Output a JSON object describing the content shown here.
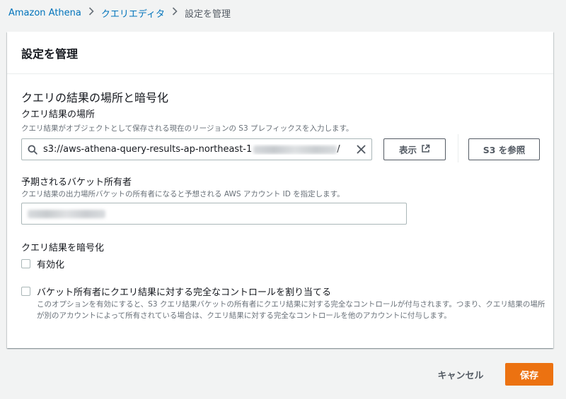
{
  "breadcrumb": {
    "items": [
      "Amazon Athena",
      "クエリエディタ"
    ],
    "current": "設定を管理",
    "separator": "›"
  },
  "panel": {
    "title": "設定を管理",
    "section_title": "クエリの結果の場所と暗号化"
  },
  "query_location": {
    "label": "クエリ結果の場所",
    "description": "クエリ結果がオブジェクトとして保存される現在のリージョンの S3 プレフィックスを入力します。",
    "value": "s3://aws-athena-query-results-ap-northeast-1",
    "value_suffix": "/",
    "view_button": "表示",
    "browse_button": "S3 を参照"
  },
  "bucket_owner": {
    "label": "予期されるバケット所有者",
    "description": "クエリ結果の出力場所バケットの所有者になると予想される AWS アカウント ID を指定します。"
  },
  "encryption": {
    "label": "クエリ結果を暗号化",
    "checkbox_label": "有効化"
  },
  "full_control": {
    "checkbox_label": "バケット所有者にクエリ結果に対する完全なコントロールを割り当てる",
    "description": "このオプションを有効にすると、S3 クエリ結果バケットの所有者にクエリ結果に対する完全なコントロールが付与されます。つまり、クエリ結果の場所が別のアカウントによって所有されている場合は、クエリ結果に対する完全なコントロールを他のアカウントに付与します。"
  },
  "footer": {
    "cancel": "キャンセル",
    "save": "保存"
  },
  "colors": {
    "link": "#0073bb",
    "primary": "#ec7211",
    "text": "#16191f",
    "muted": "#687078"
  }
}
